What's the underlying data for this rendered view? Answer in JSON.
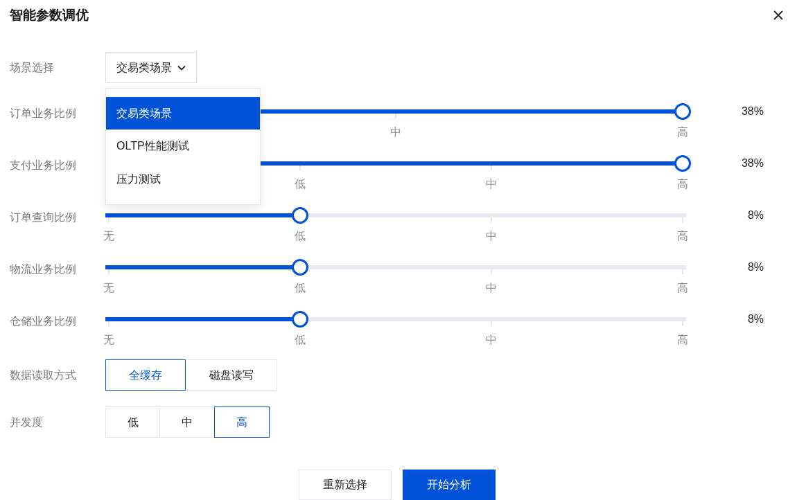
{
  "dialog": {
    "title": "智能参数调优"
  },
  "scene": {
    "label": "场景选择",
    "value": "交易类场景",
    "expanded": true,
    "options": [
      {
        "label": "交易类场景",
        "selected": true
      },
      {
        "label": "OLTP性能测试",
        "selected": false
      },
      {
        "label": "压力测试",
        "selected": false
      }
    ]
  },
  "sliders": [
    {
      "label": "订单业务比例",
      "kind": "three_step",
      "ticks": [
        "中",
        "高"
      ],
      "level": 1,
      "reading": "38%"
    },
    {
      "label": "支付业务比例",
      "kind": "four_step",
      "ticks": [
        "低",
        "中",
        "高"
      ],
      "level": 1,
      "reading": "38%"
    },
    {
      "label": "订单查询比例",
      "kind": "four_step",
      "ticks": [
        "无",
        "低",
        "中",
        "高"
      ],
      "level": 0.333,
      "reading": "8%"
    },
    {
      "label": "物流业务比例",
      "kind": "four_step",
      "ticks": [
        "无",
        "低",
        "中",
        "高"
      ],
      "level": 0.333,
      "reading": "8%"
    },
    {
      "label": "仓储业务比例",
      "kind": "four_step",
      "ticks": [
        "无",
        "低",
        "中",
        "高"
      ],
      "level": 0.333,
      "reading": "8%"
    }
  ],
  "read_mode": {
    "label": "数据读取方式",
    "options": [
      {
        "label": "全缓存",
        "selected": true
      },
      {
        "label": "磁盘读写",
        "selected": false
      }
    ]
  },
  "concurrency": {
    "label": "并发度",
    "options": [
      {
        "label": "低",
        "selected": false
      },
      {
        "label": "中",
        "selected": false
      },
      {
        "label": "高",
        "selected": true
      }
    ]
  },
  "buttons": [
    {
      "label": "重新选择",
      "kind": "secondary"
    },
    {
      "label": "开始分析",
      "kind": "primary"
    }
  ]
}
